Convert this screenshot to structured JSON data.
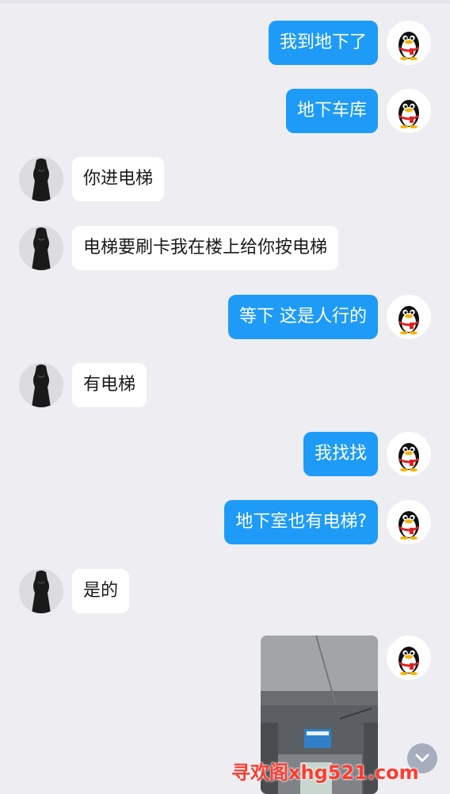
{
  "colors": {
    "background": "#ededf2",
    "self_bubble": "#1e9bf7",
    "other_bubble": "#ffffff",
    "watermark": "#ff3b30"
  },
  "messages": [
    {
      "from": "me",
      "text": "我到地下了"
    },
    {
      "from": "me",
      "text": "地下车库"
    },
    {
      "from": "other",
      "text": "你进电梯"
    },
    {
      "from": "other",
      "text": "电梯要刷卡我在楼上给你按电梯"
    },
    {
      "from": "me",
      "text": "等下 这是人行的"
    },
    {
      "from": "other",
      "text": "有电梯"
    },
    {
      "from": "me",
      "text": "我找找"
    },
    {
      "from": "me",
      "text": "地下室也有电梯?"
    },
    {
      "from": "other",
      "text": "是的"
    },
    {
      "from": "me",
      "type": "image",
      "text": ""
    }
  ],
  "icons": {
    "self_avatar": "qq-penguin-avatar-icon",
    "other_avatar": "black-dress-avatar",
    "scroll": "chevron-down-icon"
  },
  "watermark": {
    "text": "寻欢阁xhg521.com"
  }
}
